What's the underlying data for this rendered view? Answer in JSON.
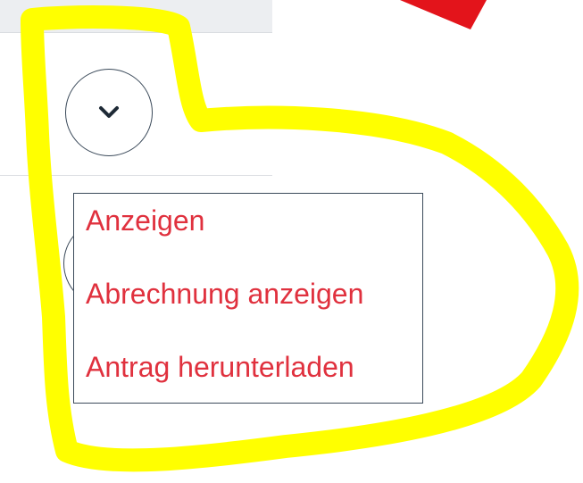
{
  "icons": {
    "expand": "chevron-down-icon",
    "annotation_arrow": "red-arrow-icon"
  },
  "colors": {
    "menu_text": "#e0313e",
    "border": "#3b4a5a",
    "highlight": "#ffff00",
    "arrow": "#e3141b",
    "top_bar": "#eceef1"
  },
  "menu": {
    "items": [
      {
        "label": "Anzeigen"
      },
      {
        "label": "Abrechnung anzeigen"
      },
      {
        "label": "Antrag herunterladen"
      }
    ]
  }
}
